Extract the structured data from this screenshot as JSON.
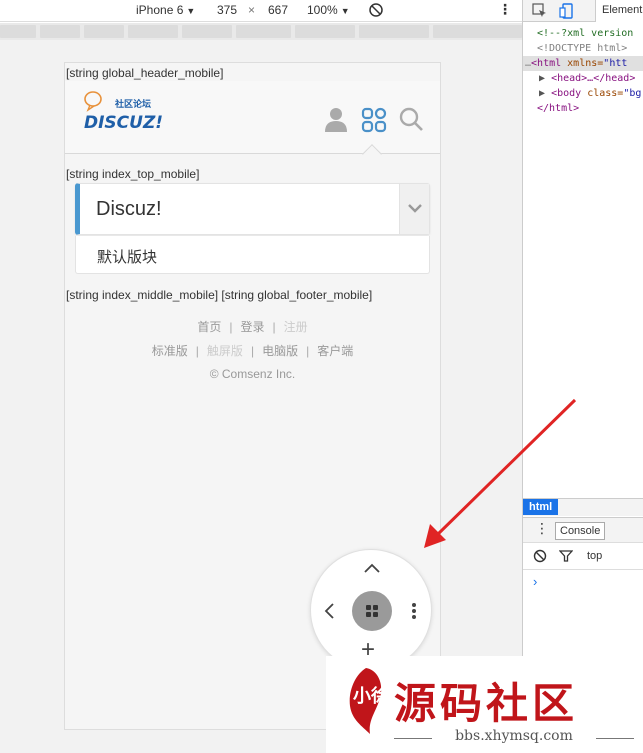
{
  "device_toolbar": {
    "device": "iPhone 6",
    "width": "375",
    "times": "×",
    "height": "667",
    "zoom": "100%"
  },
  "devtools": {
    "tab": "Element",
    "dom": {
      "line1": "<!--?xml version",
      "line2": "<!DOCTYPE html>",
      "line3_tag": "<html",
      "line3_attr": " xmlns=",
      "line3_val": "\"htt",
      "line4": "<head>…</head>",
      "line5_tag": "<body",
      "line5_attr": " class=",
      "line5_val": "\"bg",
      "line6": "</html>"
    },
    "crumb": "html",
    "console_tab": "Console",
    "context": "top",
    "prompt": "›"
  },
  "page": {
    "header_string": "[string global_header_mobile]",
    "logo_text": "社区论坛",
    "logo_brand": "DISCUZ!",
    "top_string": "[string index_top_mobile]",
    "forum_name": "Discuz!",
    "subforum": "默认版块",
    "middle_footer_string": "[string index_middle_mobile] [string global_footer_mobile]",
    "footer_links1": [
      "首页",
      "登录",
      "注册"
    ],
    "footer_links2": [
      "标准版",
      "触屏版",
      "电脑版",
      "客户端"
    ],
    "copyright": "© Comsenz Inc."
  },
  "watermark": {
    "seal_text": "小徐",
    "title": "源码社区",
    "url": "bbs.xhymsq.com"
  },
  "colors": {
    "accent": "#4a98d0",
    "icon_blue": "#4a90c8",
    "arrow": "#e02424",
    "watermark_red": "#c0151a"
  }
}
